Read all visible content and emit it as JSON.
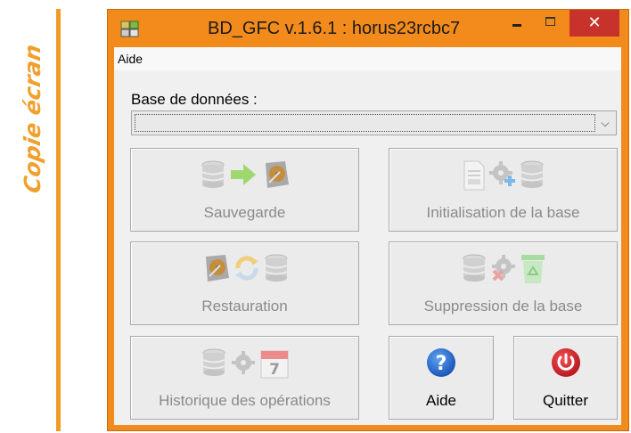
{
  "annotation": {
    "caption": "Copie écran"
  },
  "window": {
    "title": "BD_GFC v.1.6.1 : horus23rcbc7",
    "close_glyph": "✕"
  },
  "menu": {
    "aide": "Aide"
  },
  "database": {
    "label": "Base de données :",
    "selected_value": "",
    "arrow_glyph": "⌵"
  },
  "buttons": {
    "sauvegarde": "Sauvegarde",
    "initialisation": "Initialisation de la base",
    "restauration": "Restauration",
    "suppression": "Suppression de la base",
    "historique": "Historique des opérations",
    "aide": "Aide",
    "quitter": "Quitter"
  },
  "icons": {
    "backup": [
      "database-icon",
      "arrow-right-icon",
      "hard-disk-icon"
    ],
    "init": [
      "document-icon",
      "gear-plus-icon",
      "database-icon"
    ],
    "restore": [
      "hard-disk-icon",
      "refresh-icon",
      "database-icon"
    ],
    "delete": [
      "database-icon",
      "gear-delete-icon",
      "recycle-bin-icon"
    ],
    "history": [
      "database-icon",
      "gear-icon",
      "calendar-icon"
    ],
    "help": "help-icon",
    "quit": "power-icon",
    "calendar_day": "7"
  },
  "colors": {
    "window_frame": "#f28b1c",
    "close_button": "#c7332a",
    "caption_text": "#f0a02f",
    "help_blue": "#1f6fd1",
    "quit_red": "#d8222a"
  }
}
